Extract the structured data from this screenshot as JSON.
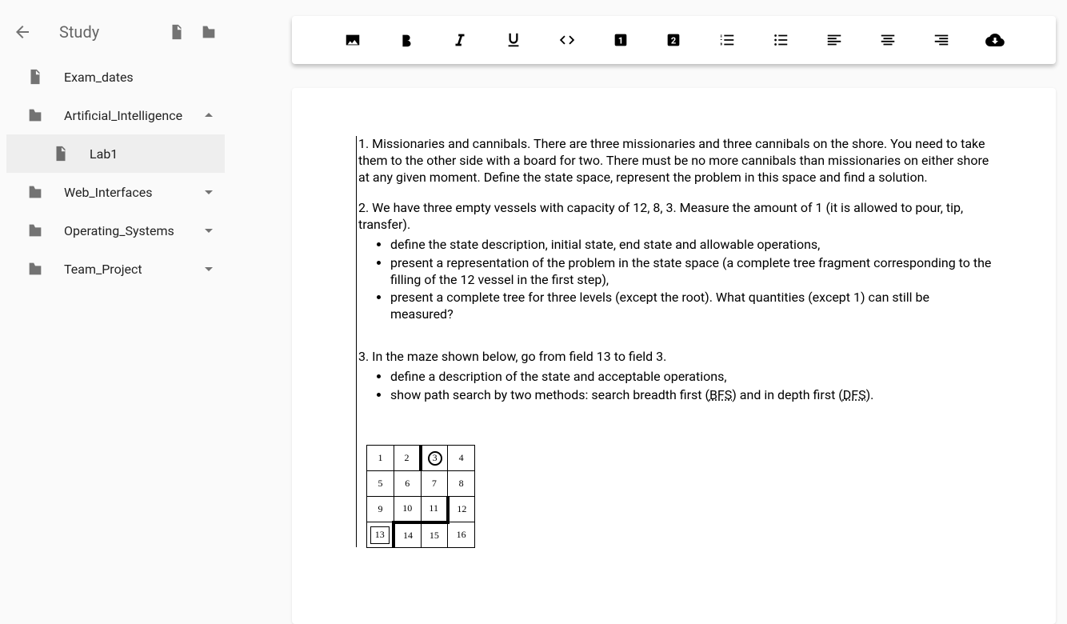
{
  "sidebar": {
    "title": "Study",
    "items": [
      {
        "type": "file",
        "label": "Exam_dates",
        "expanded": null
      },
      {
        "type": "folder",
        "label": "Artificial_Intelligence",
        "expanded": true
      },
      {
        "type": "file",
        "label": "Lab1",
        "child": true,
        "selected": true
      },
      {
        "type": "folder",
        "label": "Web_Interfaces",
        "expanded": false
      },
      {
        "type": "folder",
        "label": "Operating_Systems",
        "expanded": false
      },
      {
        "type": "folder",
        "label": "Team_Project",
        "expanded": false
      }
    ]
  },
  "toolbar": {
    "buttons": [
      "image",
      "bold",
      "italic",
      "underline",
      "code",
      "h1",
      "h2",
      "ordered-list",
      "unordered-list",
      "align-left",
      "align-center",
      "align-right",
      "download"
    ]
  },
  "document": {
    "p1": "1. Missionaries and cannibals. There are three missionaries and three cannibals on the shore. You need to take them to the other side with a board for two. There must be no more cannibals than missionaries on either shore at any given moment. Define the state space, represent the problem in this space and find a solution.",
    "p2": "2. We have three empty vessels with capacity of 12, 8, 3. Measure the amount of 1 (it is allowed to pour, tip, transfer).",
    "b2": [
      "define the state description, initial state, end state and allowable operations,",
      "present a representation of the problem in the state space (a complete tree fragment corresponding to the filling of the 12 vessel in the first step),",
      "present a complete tree for three levels (except the root). What quantities (except 1) can still be measured?"
    ],
    "p3": "3. In the maze shown below, go from field 13 to field 3.",
    "b3a": "define a description of the state and acceptable operations,",
    "b3b_pre": "show path search by two methods: search breadth first (",
    "b3b_bfs": "BFS",
    "b3b_mid": ") and in depth first (",
    "b3b_dfs": "DFS",
    "b3b_post": ")."
  },
  "maze": {
    "rows": 4,
    "cols": 4,
    "cells": [
      1,
      2,
      3,
      4,
      5,
      6,
      7,
      8,
      9,
      10,
      11,
      12,
      13,
      14,
      15,
      16
    ],
    "start": 13,
    "goal": 3
  }
}
